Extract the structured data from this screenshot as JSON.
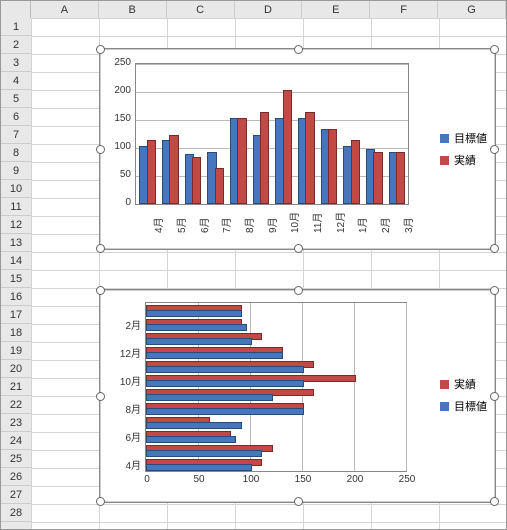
{
  "columns": [
    "A",
    "B",
    "C",
    "D",
    "E",
    "F",
    "G"
  ],
  "rows": 28,
  "chart_data": [
    {
      "type": "bar",
      "orientation": "vertical",
      "categories": [
        "4月",
        "5月",
        "6月",
        "7月",
        "8月",
        "9月",
        "10月",
        "11月",
        "12月",
        "1月",
        "2月",
        "3月"
      ],
      "series": [
        {
          "name": "目標値",
          "values": [
            100,
            110,
            85,
            90,
            150,
            120,
            150,
            150,
            130,
            100,
            95,
            90
          ]
        },
        {
          "name": "実績",
          "values": [
            110,
            120,
            80,
            60,
            150,
            160,
            200,
            160,
            130,
            110,
            90,
            90
          ]
        }
      ],
      "ylim": [
        0,
        250
      ],
      "ystep": 50,
      "legend": [
        "目標値",
        "実績"
      ]
    },
    {
      "type": "bar",
      "orientation": "horizontal",
      "categories": [
        "4月",
        "5月",
        "6月",
        "7月",
        "8月",
        "9月",
        "10月",
        "11月",
        "12月",
        "1月",
        "2月",
        "3月"
      ],
      "series": [
        {
          "name": "目標値",
          "values": [
            100,
            110,
            85,
            90,
            150,
            120,
            150,
            150,
            130,
            100,
            95,
            90
          ]
        },
        {
          "name": "実績",
          "values": [
            110,
            120,
            80,
            60,
            150,
            160,
            200,
            160,
            130,
            110,
            90,
            90
          ]
        }
      ],
      "xlim": [
        0,
        250
      ],
      "xstep": 50,
      "legend": [
        "実績",
        "目標値"
      ],
      "visible_category_labels": [
        "2月",
        "12月",
        "10月",
        "8月",
        "6月",
        "4月"
      ]
    }
  ]
}
